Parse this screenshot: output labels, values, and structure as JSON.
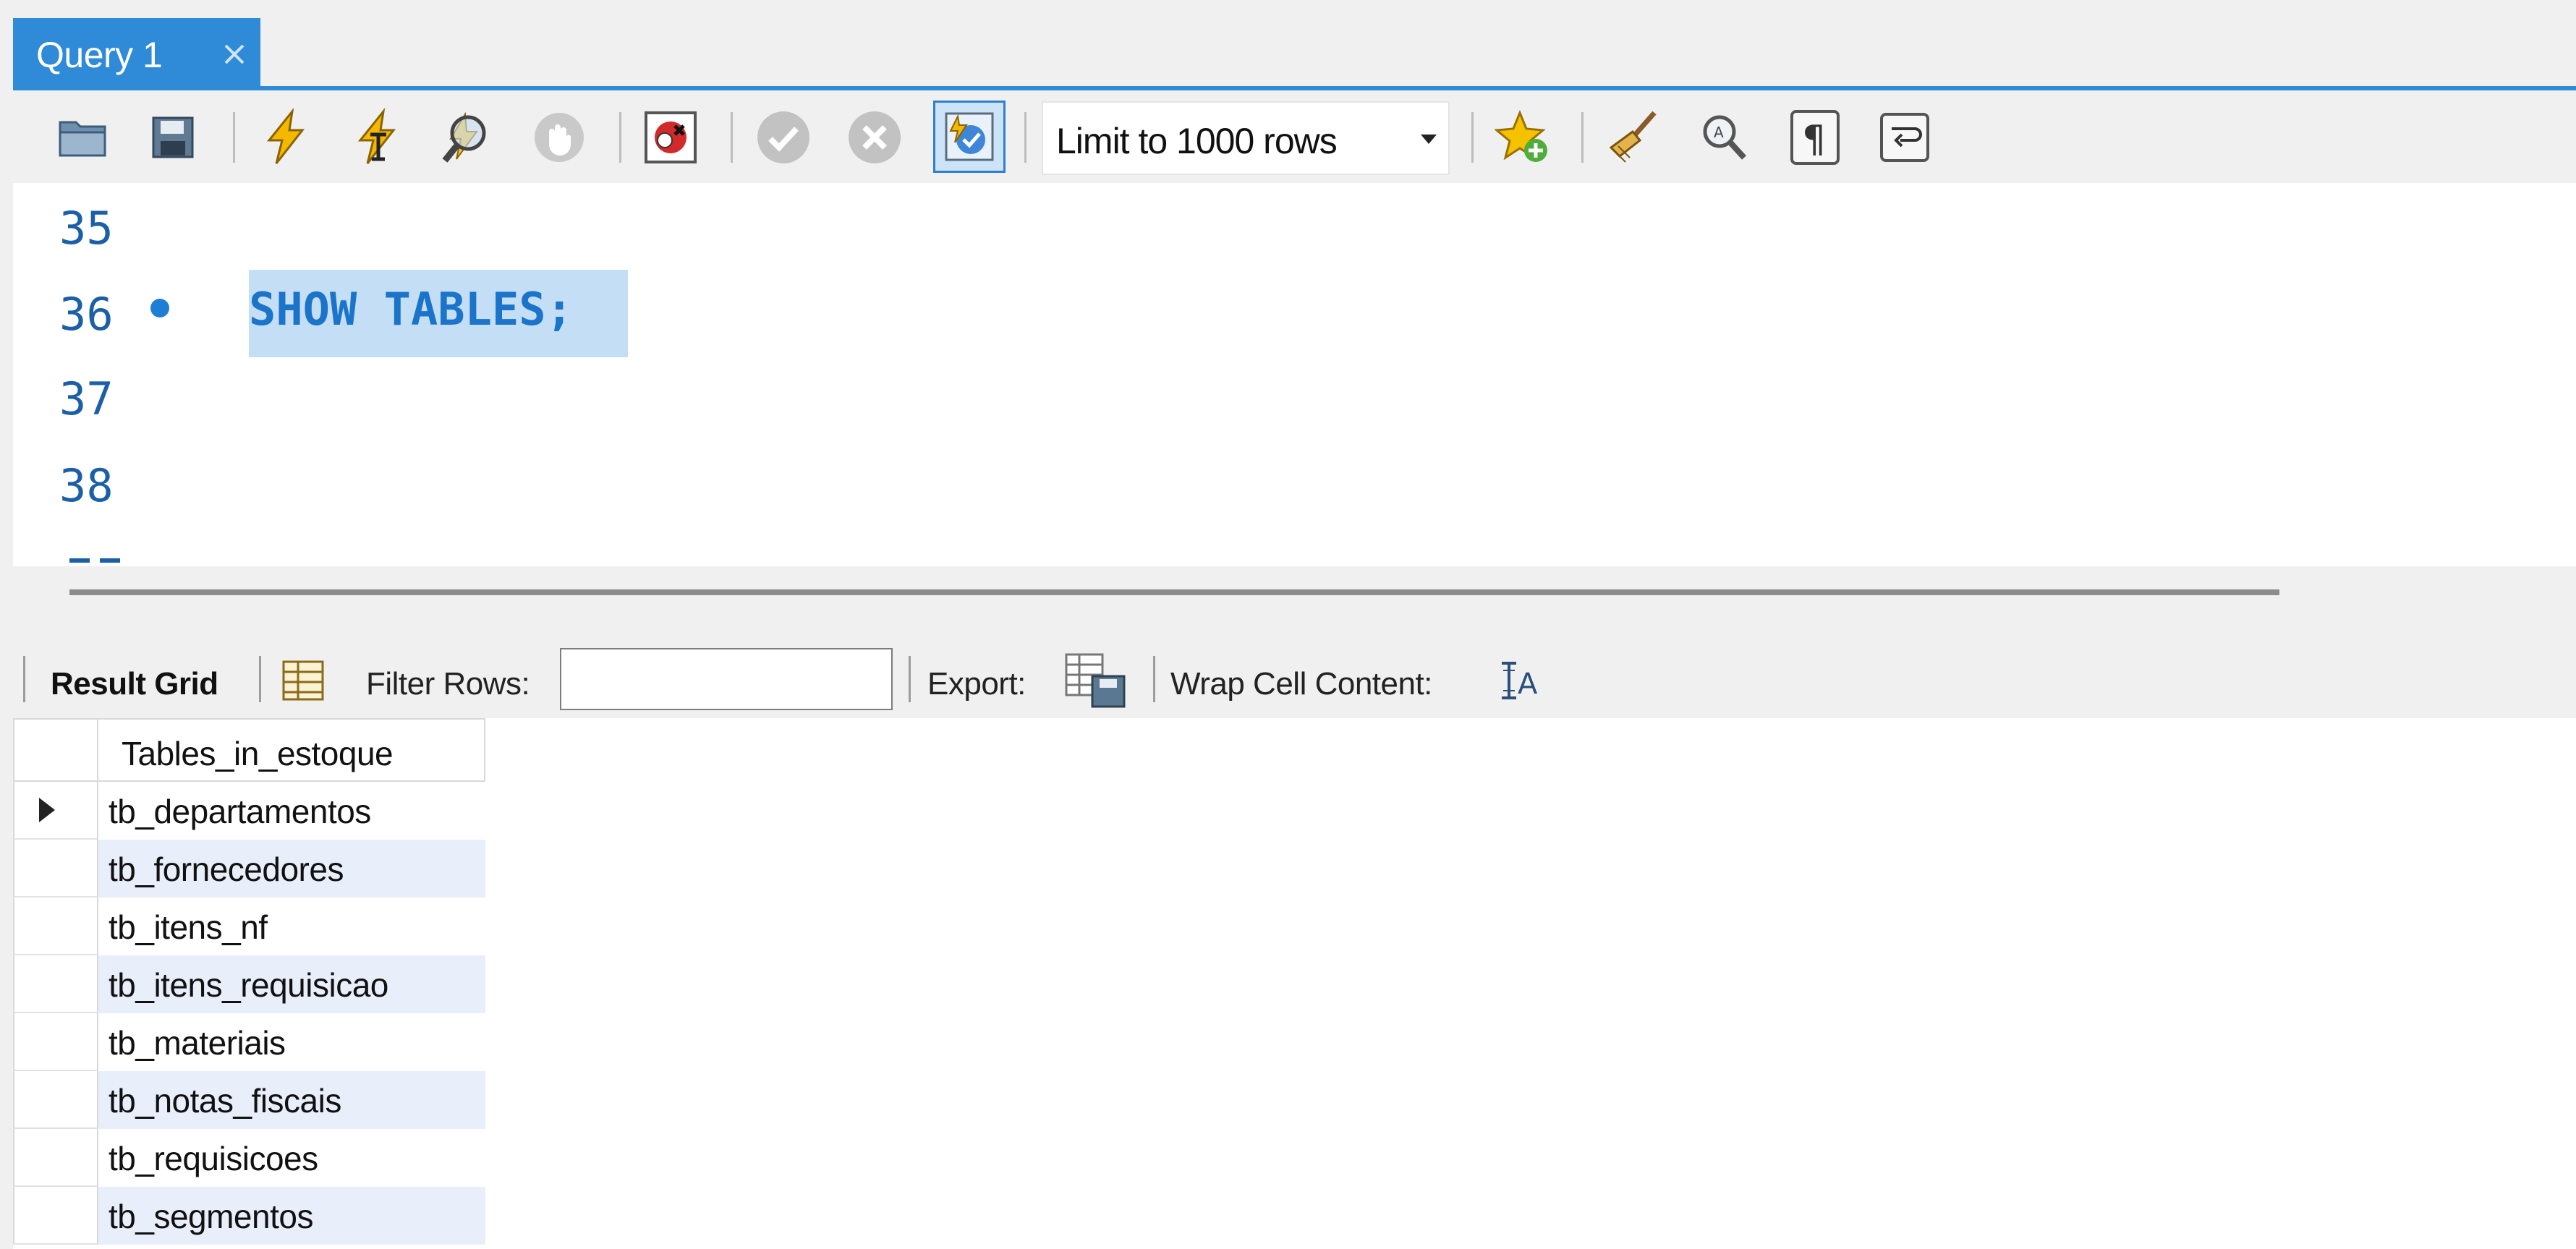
{
  "tabs": [
    {
      "label": "Query 1",
      "active": true
    }
  ],
  "toolbar": {
    "icons": [
      "open-folder-icon",
      "save-icon",
      "execute-icon",
      "execute-current-icon",
      "explain-icon",
      "stop-icon",
      "stop-on-error-icon",
      "commit-icon",
      "rollback-icon",
      "autocommit-icon",
      "add-snippet-icon",
      "beautify-icon",
      "find-icon",
      "invisible-chars-icon",
      "wrap-lines-icon"
    ],
    "limit_label": "Limit to 1000 rows"
  },
  "editor": {
    "lines": [
      {
        "number": "35",
        "code": ""
      },
      {
        "number": "36",
        "code": "SHOW TABLES;",
        "has_marker": true,
        "selected": true
      },
      {
        "number": "37",
        "code": ""
      },
      {
        "number": "38",
        "code": ""
      }
    ]
  },
  "result_toolbar": {
    "result_grid_label": "Result Grid",
    "filter_label": "Filter Rows:",
    "filter_value": "",
    "export_label": "Export:",
    "wrap_label": "Wrap Cell Content:"
  },
  "grid": {
    "column": "Tables_in_estoque",
    "rows": [
      "tb_departamentos",
      "tb_fornecedores",
      "tb_itens_nf",
      "tb_itens_requisicao",
      "tb_materiais",
      "tb_notas_fiscais",
      "tb_requisicoes",
      "tb_segmentos"
    ],
    "current_row": 0
  },
  "colors": {
    "tab_blue": "#2f8ad8",
    "keyword_blue": "#1b74c9",
    "selection": "#c4dff5",
    "alt_row": "#e8eefa"
  }
}
